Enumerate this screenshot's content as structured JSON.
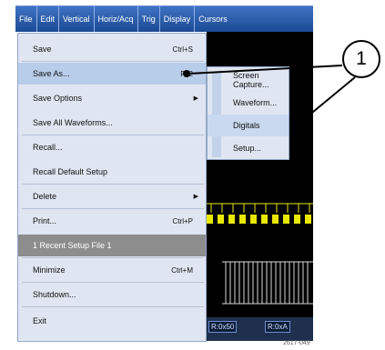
{
  "menubar": {
    "items": [
      {
        "label": "File"
      },
      {
        "label": "Edit"
      },
      {
        "label": "Vertical"
      },
      {
        "label": "Horiz/Acq"
      },
      {
        "label": "Trig"
      },
      {
        "label": "Display"
      },
      {
        "label": "Cursors"
      }
    ]
  },
  "file_menu": {
    "items": [
      {
        "label": "Save",
        "shortcut": "Ctrl+S"
      },
      {
        "label": "Save As...",
        "shortcut": "F12",
        "state": "highlighted"
      },
      {
        "label": "Save Options",
        "submenu": "▶"
      },
      {
        "label": "Save All Waveforms..."
      },
      {
        "label": "Recall..."
      },
      {
        "label": "Recall Default Setup"
      },
      {
        "label": "Delete",
        "submenu": "▶"
      },
      {
        "label": "Print...",
        "shortcut": "Ctrl+P"
      },
      {
        "label": "1 Recent Setup File 1",
        "state": "disabled"
      },
      {
        "label": "Minimize",
        "shortcut": "Ctrl+M"
      },
      {
        "label": "Shutdown..."
      },
      {
        "label": "Exit"
      }
    ]
  },
  "save_as_submenu": {
    "items": [
      {
        "label": "Screen Capture..."
      },
      {
        "label": "Waveform..."
      },
      {
        "label": "Digitals",
        "state": "highlighted"
      },
      {
        "label": "Setup..."
      }
    ]
  },
  "callout": {
    "number": "1"
  },
  "scope": {
    "readouts": [
      "R:0x50",
      "R:0xA"
    ]
  },
  "figure_id": "2617-049",
  "colors": {
    "menubar": "#2a5db0",
    "menu_bg": "#dfe6f1",
    "highlight": "#b8cde9",
    "disabled_row": "#8d8d8d",
    "digital_yellow": "#e8e800",
    "scope_bg": "#000000"
  }
}
